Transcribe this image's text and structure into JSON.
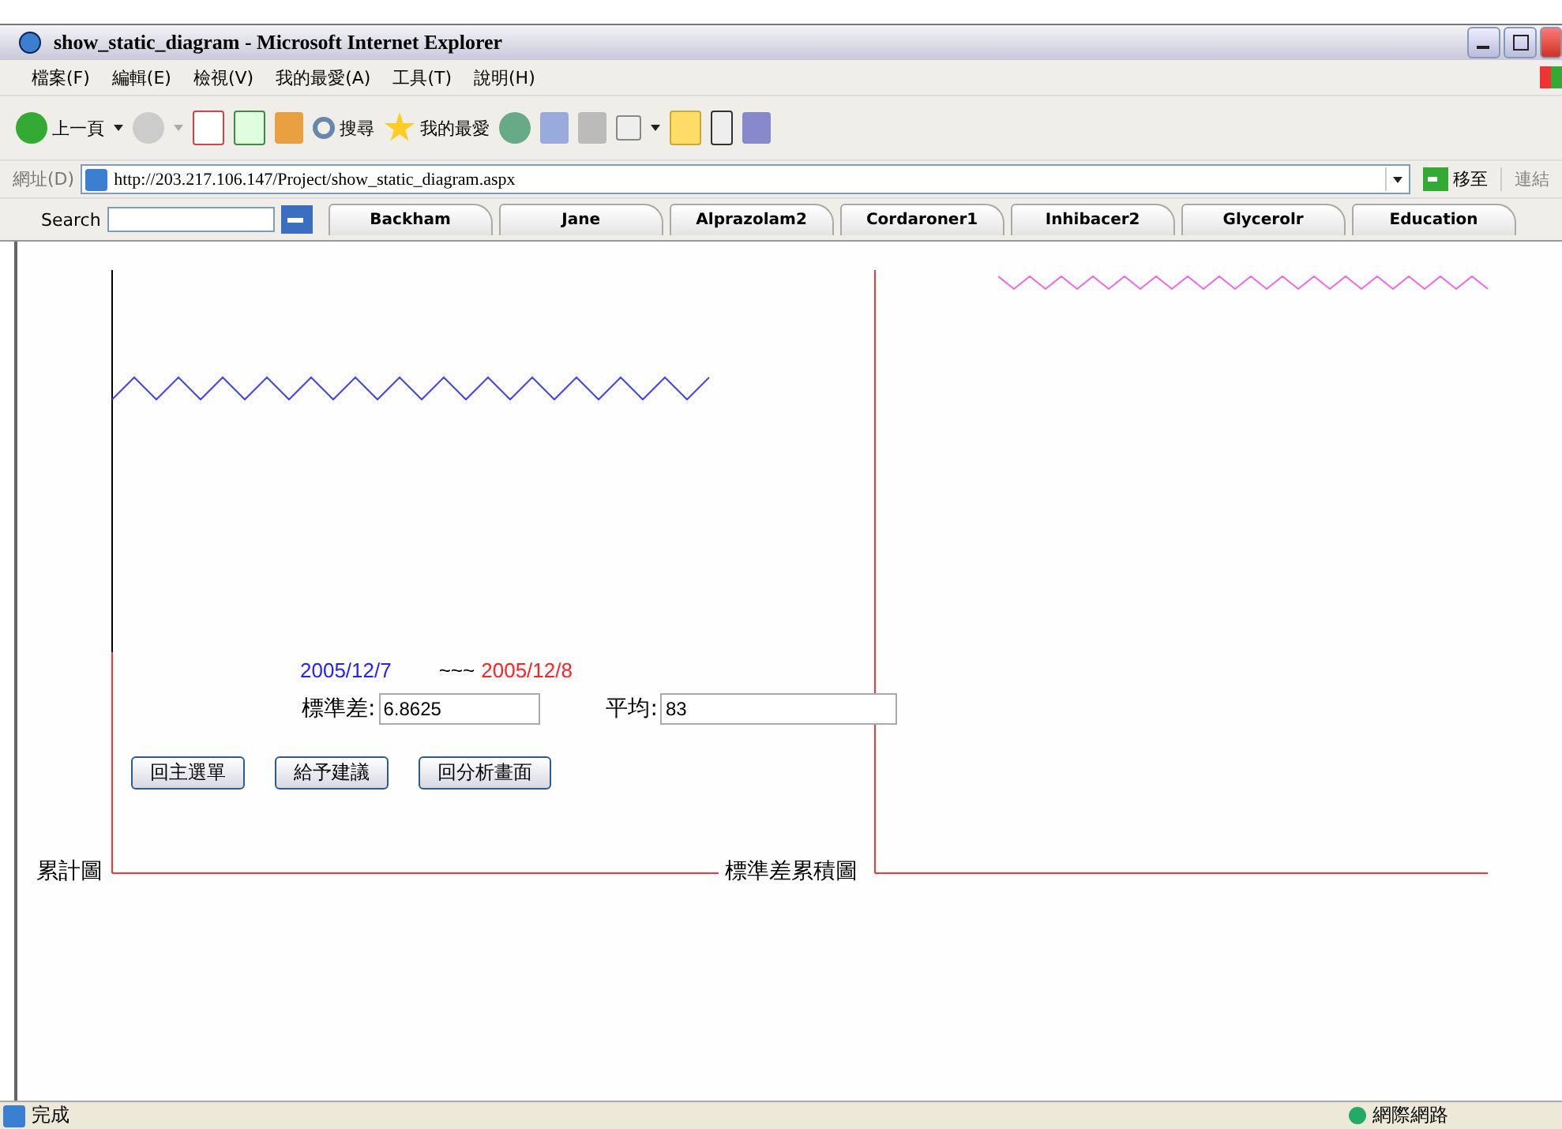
{
  "window": {
    "title": "show_static_diagram - Microsoft Internet Explorer"
  },
  "menu": [
    "檔案(F)",
    "編輯(E)",
    "檢視(V)",
    "我的最愛(A)",
    "工具(T)",
    "說明(H)"
  ],
  "toolbar": {
    "back": "上一頁",
    "search": "搜尋",
    "favorites": "我的最愛"
  },
  "address": {
    "label": "網址(D)",
    "url": "http://203.217.106.147/Project/show_static_diagram.aspx",
    "go": "移至",
    "links": "連結"
  },
  "links_bar": {
    "search_label": "Search",
    "tabs": [
      "Backham",
      "Jane",
      "Alprazolam2",
      "Cordaroner1",
      "Inhibacer2",
      "Glycerolr",
      "Education"
    ]
  },
  "page": {
    "start_date": "2005/12/7",
    "separator": "~~~",
    "end_date": "2005/12/8",
    "std_label": "標準差:",
    "std_value": "6.8625",
    "mean_label": "平均:",
    "mean_value": "83",
    "buttons": [
      "回主選單",
      "給予建議",
      "回分析畫面"
    ],
    "chart_labels": [
      "累計圖",
      "標準差累積圖"
    ]
  },
  "status_bar": {
    "text": "完成",
    "zone": "網際網路"
  }
}
